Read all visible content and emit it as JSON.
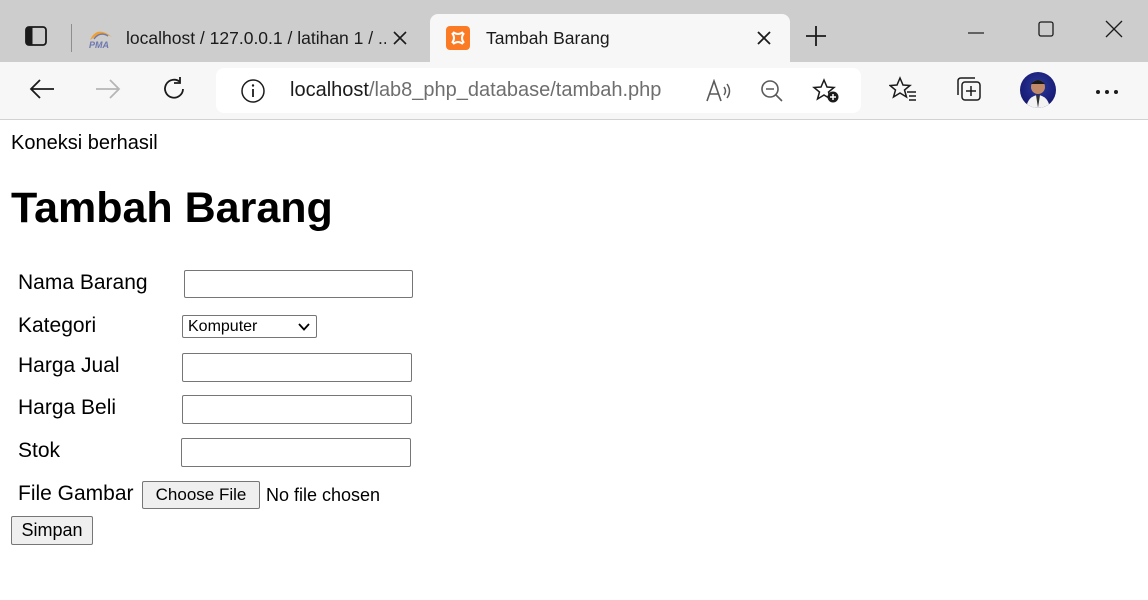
{
  "browser": {
    "tabs": [
      {
        "title": "localhost / 127.0.0.1 / latihan 1 / ...",
        "favicon": "phpmyadmin-icon",
        "active": false
      },
      {
        "title": "Tambah Barang",
        "favicon": "xampp-icon",
        "active": true
      }
    ],
    "address": {
      "host": "localhost",
      "path": "/lab8_php_database/tambah.php"
    },
    "icons": {
      "back": "back-arrow-icon",
      "forward": "forward-arrow-icon",
      "reload": "reload-icon",
      "read_aloud": "read-aloud-icon",
      "zoom_out": "zoom-out-icon",
      "add_favorite": "add-favorite-icon",
      "favorites": "favorites-icon",
      "collections": "collections-icon",
      "more": "more-icon"
    }
  },
  "page": {
    "status": "Koneksi berhasil",
    "title": "Tambah Barang",
    "form": {
      "labels": {
        "nama": "Nama Barang",
        "kategori": "Kategori",
        "harga_jual": "Harga Jual",
        "harga_beli": "Harga Beli",
        "stok": "Stok",
        "file": "File Gambar"
      },
      "values": {
        "nama": "",
        "harga_jual": "",
        "harga_beli": "",
        "stok": ""
      },
      "kategori_selected": "Komputer",
      "file_button": "Choose File",
      "file_status": "No file chosen",
      "submit": "Simpan"
    }
  }
}
